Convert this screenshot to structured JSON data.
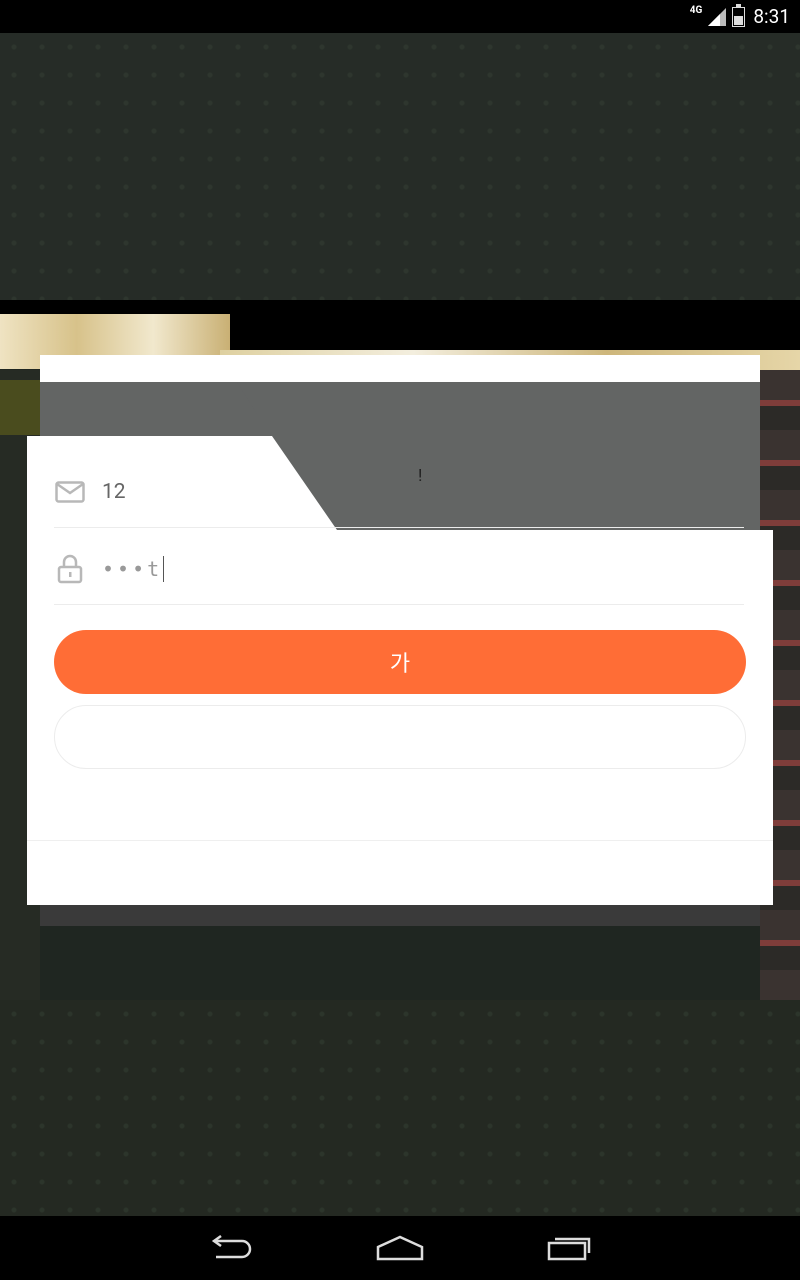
{
  "status_bar": {
    "network_label": "4G",
    "time": "8:31"
  },
  "login_dialog": {
    "notice_text": "!",
    "email_field": {
      "value": "12",
      "icon": "mail-icon"
    },
    "password_field": {
      "value": "•••t",
      "icon": "lock-icon"
    },
    "login_button_label": "가",
    "secondary_button_label": ""
  },
  "nav_bar": {
    "back_icon": "back-icon",
    "home_icon": "home-icon",
    "recents_icon": "recents-icon"
  },
  "colors": {
    "accent": "#ff6d36",
    "overlay_gray": "#636564",
    "background": "#1f2621"
  }
}
